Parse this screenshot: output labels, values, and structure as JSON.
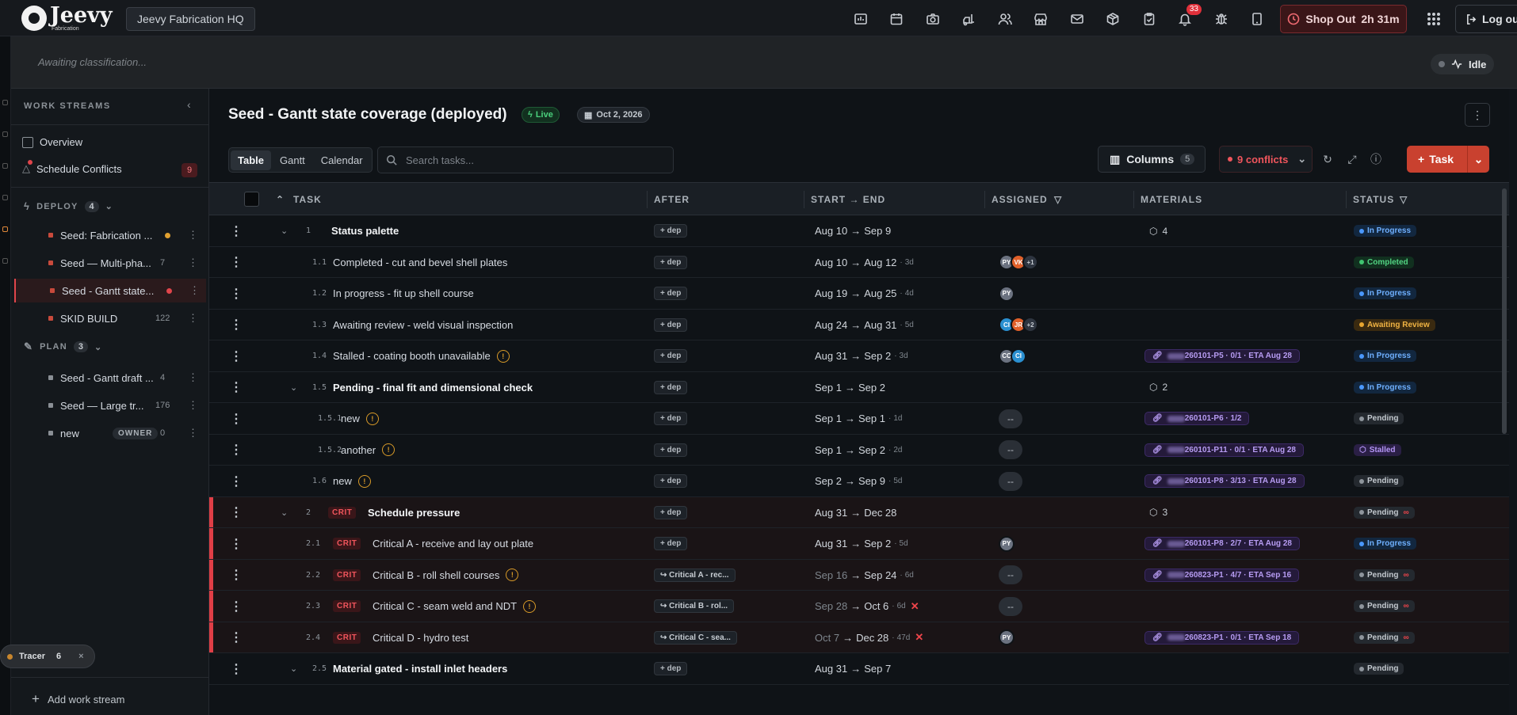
{
  "header": {
    "logo_name": "Jeevy",
    "logo_sub": "Fabrication",
    "workspace": "Jeevy Fabrication HQ",
    "icons": [
      "reports-icon",
      "calendar-icon",
      "camera-icon",
      "forklift-icon",
      "users-icon",
      "store-icon",
      "mail-icon",
      "package-icon",
      "clipboard-icon",
      "bell-icon",
      "bug-icon",
      "tablet-icon"
    ],
    "notification_count": "33",
    "shop_out_label": "Shop Out",
    "shop_out_time": "2h 31m",
    "logout_label": "Log out"
  },
  "classification": {
    "text": "Awaiting classification...",
    "status": "Idle"
  },
  "sidebar": {
    "heading": "WORK STREAMS",
    "overview": "Overview",
    "conflicts_label": "Schedule Conflicts",
    "conflicts_count": "9",
    "deploy_label": "DEPLOY",
    "deploy_count": "4",
    "deploy_items": [
      {
        "name": "Seed: Fabrication ...",
        "count": "",
        "dot": "#e0a030"
      },
      {
        "name": "Seed — Multi-pha...",
        "count": "7",
        "dot": ""
      },
      {
        "name": "Seed - Gantt state...",
        "count": "",
        "dot": "#e0454b"
      },
      {
        "name": "SKID BUILD",
        "count": "122",
        "dot": ""
      }
    ],
    "plan_label": "PLAN",
    "plan_count": "3",
    "plan_items": [
      {
        "name": "Seed - Gantt draft ...",
        "count": "4"
      },
      {
        "name": "Seed — Large tr...",
        "count": "176"
      },
      {
        "name": "new",
        "count": "0",
        "badge": "OWNER"
      }
    ],
    "tracer_label": "Tracer",
    "tracer_count": "6",
    "add_label": "Add work stream"
  },
  "main": {
    "title": "Seed - Gantt state coverage (deployed)",
    "live": "Live",
    "date": "Oct 2, 2026",
    "tabs": [
      "Table",
      "Gantt",
      "Calendar"
    ],
    "search_placeholder": "Search tasks...",
    "columns_label": "Columns",
    "columns_count": "5",
    "conflicts_label": "9 conflicts",
    "task_button": "Task"
  },
  "table": {
    "headers": {
      "task": "TASK",
      "after": "AFTER",
      "dates": "START → END",
      "assigned": "ASSIGNED",
      "materials": "MATERIALS",
      "status": "STATUS"
    },
    "rows": [
      {
        "lvl": 0,
        "chev": "⌄",
        "num": "1",
        "name": "Status palette",
        "bold": true,
        "crit": false,
        "warn": false,
        "after": "+ dep",
        "start": "Aug 10",
        "end": "Sep 9",
        "dur": "",
        "x": false,
        "greyStart": false,
        "assigned": [],
        "dash": false,
        "mat": "",
        "matCount": "4",
        "status": "In Progress",
        "stype": "inprog",
        "inf": false
      },
      {
        "lvl": 1,
        "chev": "",
        "num": "1.1",
        "name": "Completed - cut and bevel shell plates",
        "bold": false,
        "crit": false,
        "warn": false,
        "after": "+ dep",
        "start": "Aug 10",
        "end": "Aug 12",
        "dur": "3d",
        "x": false,
        "greyStart": false,
        "assigned": [
          {
            "t": "PY",
            "c": "#6b7280"
          },
          {
            "t": "VK",
            "c": "#e0602a"
          },
          {
            "t": "+1",
            "c": "more"
          }
        ],
        "dash": false,
        "mat": "",
        "matCount": "",
        "status": "Completed",
        "stype": "comp",
        "inf": false
      },
      {
        "lvl": 1,
        "chev": "",
        "num": "1.2",
        "name": "In progress - fit up shell course",
        "bold": false,
        "crit": false,
        "warn": false,
        "after": "+ dep",
        "start": "Aug 19",
        "end": "Aug 25",
        "dur": "4d",
        "x": false,
        "greyStart": false,
        "assigned": [
          {
            "t": "PY",
            "c": "#6b7280"
          }
        ],
        "dash": false,
        "mat": "",
        "matCount": "",
        "status": "In Progress",
        "stype": "inprog",
        "inf": false
      },
      {
        "lvl": 1,
        "chev": "",
        "num": "1.3",
        "name": "Awaiting review - weld visual inspection",
        "bold": false,
        "crit": false,
        "warn": false,
        "after": "+ dep",
        "start": "Aug 24",
        "end": "Aug 31",
        "dur": "5d",
        "x": false,
        "greyStart": false,
        "assigned": [
          {
            "t": "CI",
            "c": "#2a8fd0"
          },
          {
            "t": "JR",
            "c": "#e0602a"
          },
          {
            "t": "+2",
            "c": "more"
          }
        ],
        "dash": false,
        "mat": "",
        "matCount": "",
        "status": "Awaiting Review",
        "stype": "await",
        "inf": false
      },
      {
        "lvl": 1,
        "chev": "",
        "num": "1.4",
        "name": "Stalled - coating booth unavailable",
        "bold": false,
        "crit": false,
        "warn": true,
        "after": "+ dep",
        "start": "Aug 31",
        "end": "Sep 2",
        "dur": "3d",
        "x": false,
        "greyStart": false,
        "assigned": [
          {
            "t": "CC",
            "c": "#6b7280"
          },
          {
            "t": "CI",
            "c": "#2a8fd0"
          }
        ],
        "dash": false,
        "mat": "260101-P5 · 0/1 · ETA Aug 28",
        "matCount": "",
        "status": "In Progress",
        "stype": "inprog",
        "inf": false
      },
      {
        "lvl": 1,
        "chev": "⌄",
        "num": "1.5",
        "name": "Pending - final fit and dimensional check",
        "bold": true,
        "crit": false,
        "warn": false,
        "after": "+ dep",
        "start": "Sep 1",
        "end": "Sep 2",
        "dur": "",
        "x": false,
        "greyStart": false,
        "assigned": [],
        "dash": false,
        "mat": "",
        "matCount": "2",
        "status": "In Progress",
        "stype": "inprog",
        "inf": false
      },
      {
        "lvl": 2,
        "chev": "",
        "num": "1.5.1",
        "name": "new",
        "bold": false,
        "crit": false,
        "warn": true,
        "after": "+ dep",
        "start": "Sep 1",
        "end": "Sep 1",
        "dur": "1d",
        "x": false,
        "greyStart": false,
        "assigned": [],
        "dash": true,
        "mat": "260101-P6 · 1/2",
        "matCount": "",
        "status": "Pending",
        "stype": "pend",
        "inf": false
      },
      {
        "lvl": 2,
        "chev": "",
        "num": "1.5.2",
        "name": "another",
        "bold": false,
        "crit": false,
        "warn": true,
        "after": "+ dep",
        "start": "Sep 1",
        "end": "Sep 2",
        "dur": "2d",
        "x": false,
        "greyStart": false,
        "assigned": [],
        "dash": true,
        "mat": "260101-P11 · 0/1 · ETA Aug 28",
        "matCount": "",
        "status": "Stalled",
        "stype": "stall",
        "inf": false
      },
      {
        "lvl": 1,
        "chev": "",
        "num": "1.6",
        "name": "new",
        "bold": false,
        "crit": false,
        "warn": true,
        "after": "+ dep",
        "start": "Sep 2",
        "end": "Sep 9",
        "dur": "5d",
        "x": false,
        "greyStart": false,
        "assigned": [],
        "dash": true,
        "mat": "260101-P8 · 3/13 · ETA Aug 28",
        "matCount": "",
        "status": "Pending",
        "stype": "pend",
        "inf": false
      },
      {
        "lvl": 0,
        "chev": "⌄",
        "num": "2",
        "name": "Schedule pressure",
        "bold": true,
        "crit": true,
        "warn": false,
        "after": "+ dep",
        "start": "Aug 31",
        "end": "Dec 28",
        "dur": "",
        "x": false,
        "greyStart": false,
        "assigned": [],
        "dash": false,
        "mat": "",
        "matCount": "3",
        "status": "Pending",
        "stype": "pend",
        "inf": true
      },
      {
        "lvl": 1,
        "chev": "",
        "num": "2.1",
        "name": "Critical A - receive and lay out plate",
        "bold": false,
        "crit": true,
        "warn": false,
        "after": "+ dep",
        "start": "Aug 31",
        "end": "Sep 2",
        "dur": "5d",
        "x": false,
        "greyStart": false,
        "assigned": [
          {
            "t": "PY",
            "c": "#6b7280"
          }
        ],
        "dash": false,
        "mat": "260101-P8 · 2/7 · ETA Aug 28",
        "matCount": "",
        "status": "In Progress",
        "stype": "inprog",
        "inf": false
      },
      {
        "lvl": 1,
        "chev": "",
        "num": "2.2",
        "name": "Critical B - roll shell courses",
        "bold": false,
        "crit": true,
        "warn": true,
        "after": "↪ Critical A - rec...",
        "start": "Sep 16",
        "end": "Sep 24",
        "dur": "6d",
        "x": false,
        "greyStart": true,
        "assigned": [],
        "dash": true,
        "mat": "260823-P1 · 4/7 · ETA Sep 16",
        "matCount": "",
        "status": "Pending",
        "stype": "pend",
        "inf": true
      },
      {
        "lvl": 1,
        "chev": "",
        "num": "2.3",
        "name": "Critical C - seam weld and NDT",
        "bold": false,
        "crit": true,
        "warn": true,
        "after": "↪ Critical B - rol...",
        "start": "Sep 28",
        "end": "Oct 6",
        "dur": "6d",
        "x": true,
        "greyStart": true,
        "assigned": [],
        "dash": true,
        "mat": "",
        "matCount": "",
        "status": "Pending",
        "stype": "pend",
        "inf": true
      },
      {
        "lvl": 1,
        "chev": "",
        "num": "2.4",
        "name": "Critical D - hydro test",
        "bold": false,
        "crit": true,
        "warn": false,
        "after": "↪ Critical C - sea...",
        "start": "Oct 7",
        "end": "Dec 28",
        "dur": "47d",
        "x": true,
        "greyStart": true,
        "assigned": [
          {
            "t": "PY",
            "c": "#6b7280"
          }
        ],
        "dash": false,
        "mat": "260823-P1 · 0/1 · ETA Sep 18",
        "matCount": "",
        "status": "Pending",
        "stype": "pend",
        "inf": true
      },
      {
        "lvl": 1,
        "chev": "⌄",
        "num": "2.5",
        "name": "Material gated - install inlet headers",
        "bold": true,
        "crit": false,
        "warn": false,
        "after": "+ dep",
        "start": "Aug 31",
        "end": "Sep 7",
        "dur": "",
        "x": false,
        "greyStart": false,
        "assigned": [],
        "dash": false,
        "mat": "",
        "matCount": "",
        "status": "Pending",
        "stype": "pend",
        "inf": false
      }
    ]
  }
}
